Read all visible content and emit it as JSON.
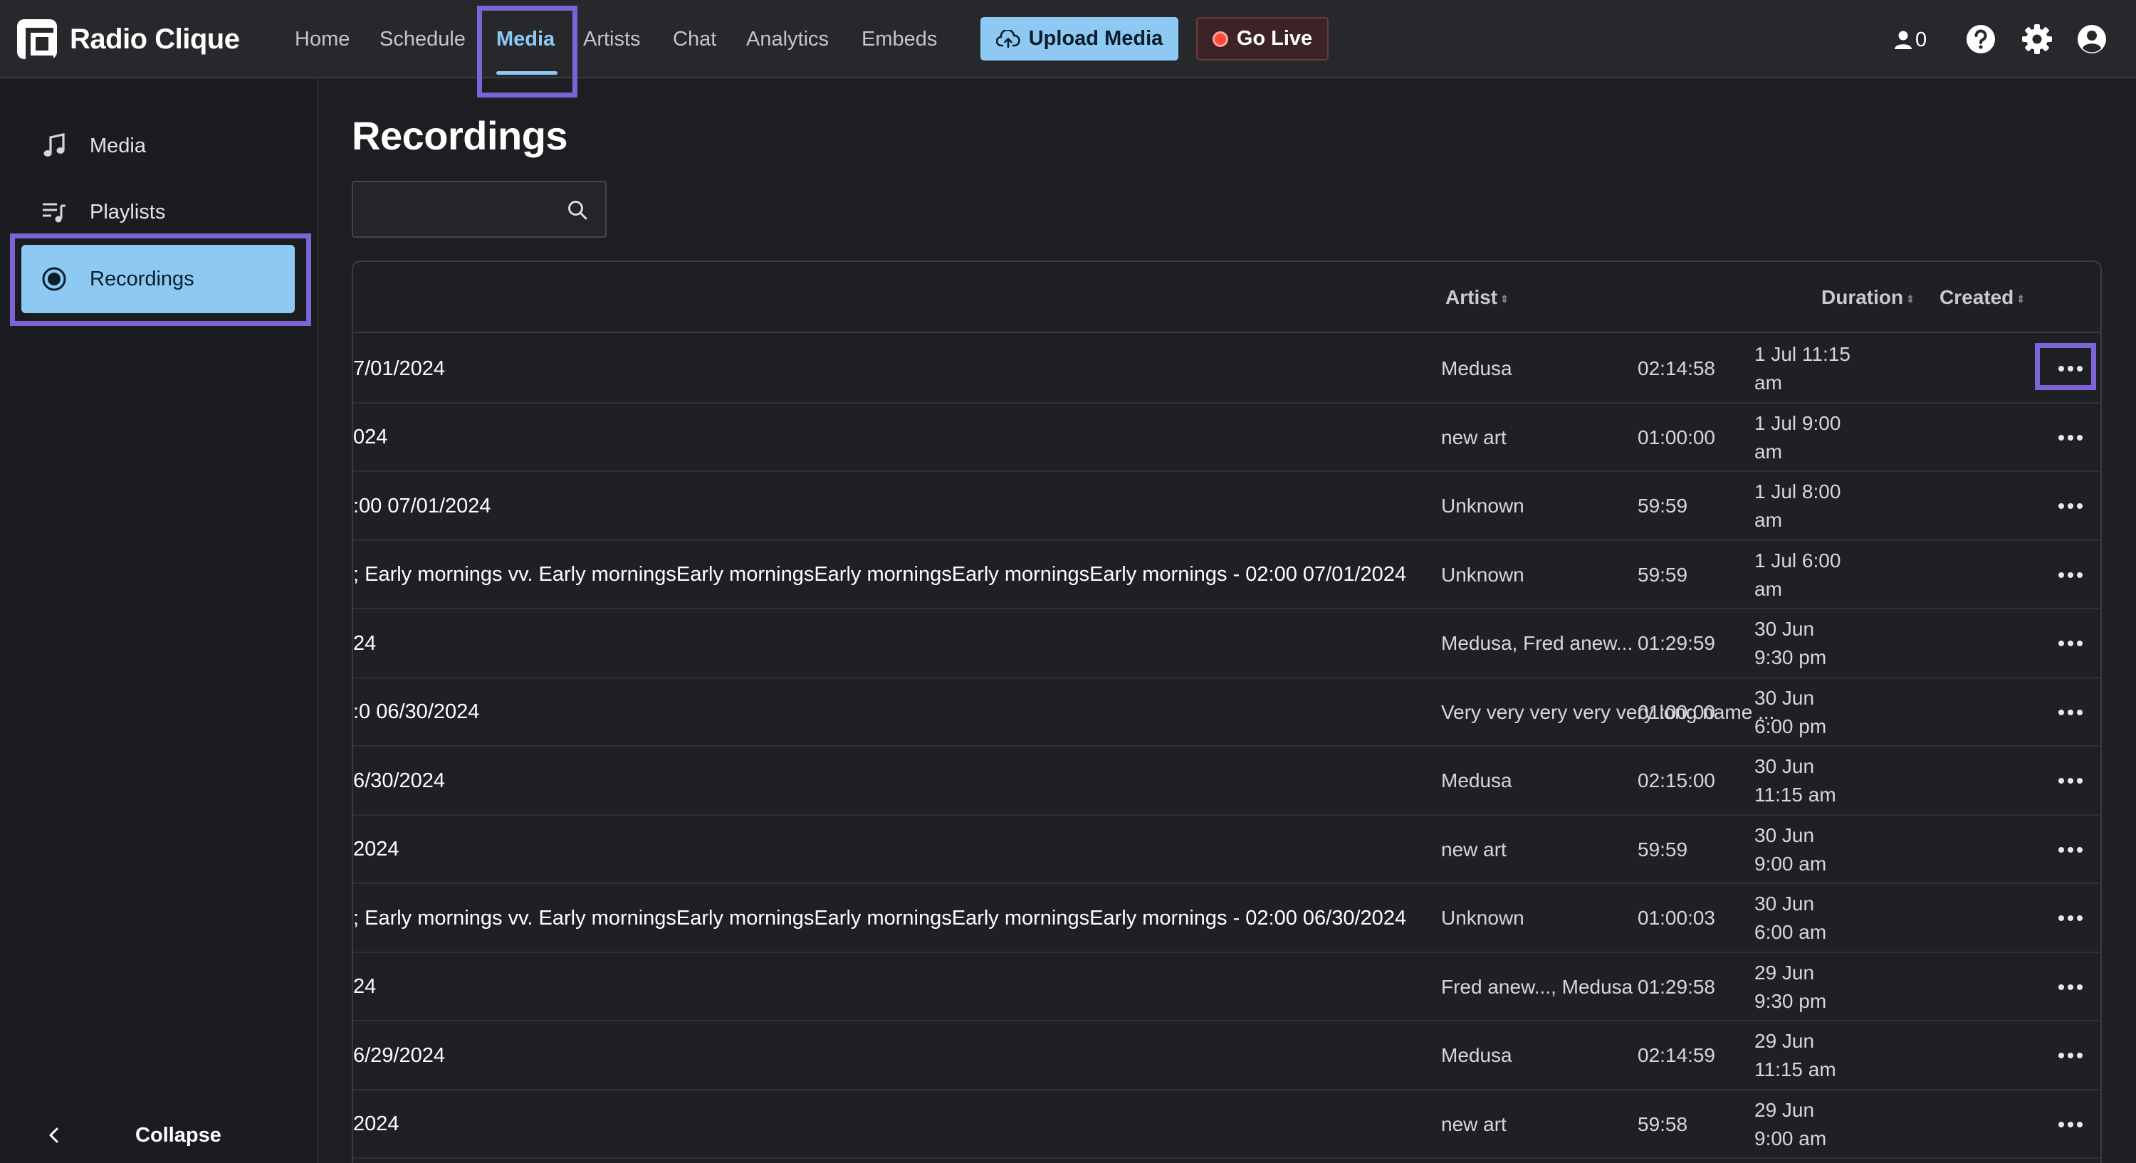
{
  "app": {
    "name": "Radio Clique"
  },
  "nav": {
    "items": [
      {
        "label": "Home"
      },
      {
        "label": "Schedule"
      },
      {
        "label": "Media"
      },
      {
        "label": "Artists"
      },
      {
        "label": "Chat"
      },
      {
        "label": "Analytics"
      },
      {
        "label": "Embeds"
      }
    ],
    "active": "Media",
    "upload_label": "Upload Media",
    "golive_label": "Go Live",
    "listener_count": "0"
  },
  "sidebar": {
    "items": [
      {
        "label": "Media",
        "icon": "music-note-icon"
      },
      {
        "label": "Playlists",
        "icon": "playlist-icon"
      },
      {
        "label": "Recordings",
        "icon": "record-icon"
      }
    ],
    "active": "Recordings",
    "collapse_label": "Collapse"
  },
  "page": {
    "title": "Recordings"
  },
  "search": {
    "value": "",
    "placeholder": ""
  },
  "table": {
    "headers": {
      "artist": "Artist",
      "duration": "Duration",
      "created": "Created"
    },
    "rows": [
      {
        "name": "7/01/2024",
        "artist": "Medusa",
        "duration": "02:14:58",
        "created": "1 Jul 11:15 am"
      },
      {
        "name": "024",
        "artist": "new art",
        "duration": "01:00:00",
        "created": "1 Jul 9:00 am"
      },
      {
        "name": ":00 07/01/2024",
        "artist": "Unknown",
        "duration": "59:59",
        "created": "1 Jul 8:00 am"
      },
      {
        "name": "; Early mornings vv. Early morningsEarly morningsEarly morningsEarly morningsEarly mornings - 02:00 07/01/2024",
        "artist": "Unknown",
        "duration": "59:59",
        "created": "1 Jul 6:00 am"
      },
      {
        "name": "24",
        "artist": "Medusa, Fred anew...",
        "duration": "01:29:59",
        "created": "30 Jun 9:30 pm"
      },
      {
        "name": ":0 06/30/2024",
        "artist": "Very very very very very long name ...",
        "duration": "01:00:00",
        "created": "30 Jun 6:00 pm"
      },
      {
        "name": "6/30/2024",
        "artist": "Medusa",
        "duration": "02:15:00",
        "created": "30 Jun 11:15 am"
      },
      {
        "name": "2024",
        "artist": "new art",
        "duration": "59:59",
        "created": "30 Jun 9:00 am"
      },
      {
        "name": "; Early mornings vv. Early morningsEarly morningsEarly morningsEarly morningsEarly mornings - 02:00 06/30/2024",
        "artist": "Unknown",
        "duration": "01:00:03",
        "created": "30 Jun 6:00 am"
      },
      {
        "name": "24",
        "artist": "Fred anew..., Medusa",
        "duration": "01:29:58",
        "created": "29 Jun 9:30 pm"
      },
      {
        "name": "6/29/2024",
        "artist": "Medusa",
        "duration": "02:14:59",
        "created": "29 Jun 11:15 am"
      },
      {
        "name": "2024",
        "artist": "new art",
        "duration": "59:58",
        "created": "29 Jun 9:00 am"
      }
    ]
  },
  "colors": {
    "accent": "#8ec9f3",
    "highlight": "#7c63d6",
    "live": "#ff4a3a"
  }
}
